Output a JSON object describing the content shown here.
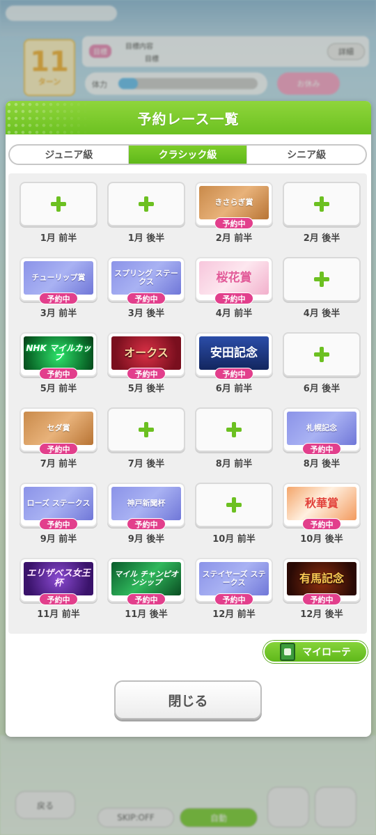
{
  "background": {
    "turn_number": "11",
    "turn_unit": "ターン",
    "goal_tag": "目標",
    "goal_line1": "目標内容",
    "goal_line2": "目標",
    "goal_button": "詳細",
    "energy_label": "体力",
    "energy_fraction": 0.14,
    "pink_button": "お休み",
    "bottom_buttons": {
      "back": "戻る",
      "skip": "SKIP:OFF",
      "auto": "自動"
    }
  },
  "modal": {
    "title": "予約レース一覧",
    "tabs": [
      {
        "label": "ジュニア級",
        "active": false
      },
      {
        "label": "クラシック級",
        "active": true
      },
      {
        "label": "シニア級",
        "active": false
      }
    ],
    "reserved_badge": "予約中",
    "slots": [
      {
        "label": "1月 前半",
        "race": null,
        "style": null
      },
      {
        "label": "1月 後半",
        "race": null,
        "style": null
      },
      {
        "label": "2月 前半",
        "race": "きさらぎ賞",
        "style": "b-bronze"
      },
      {
        "label": "2月 後半",
        "race": null,
        "style": null
      },
      {
        "label": "3月 前半",
        "race": "チューリップ賞",
        "style": "b-blue"
      },
      {
        "label": "3月 後半",
        "race": "スプリング ステークス",
        "style": "b-blue"
      },
      {
        "label": "4月 前半",
        "race": "桜花賞",
        "style": "b-pink"
      },
      {
        "label": "4月 後半",
        "race": null,
        "style": null
      },
      {
        "label": "5月 前半",
        "race": "NHK マイルカップ",
        "style": "b-green"
      },
      {
        "label": "5月 後半",
        "race": "オークス",
        "style": "b-red"
      },
      {
        "label": "6月 前半",
        "race": "安田記念",
        "style": "b-navy"
      },
      {
        "label": "6月 後半",
        "race": null,
        "style": null
      },
      {
        "label": "7月 前半",
        "race": "セダ賞",
        "style": "b-bronze"
      },
      {
        "label": "7月 後半",
        "race": null,
        "style": null
      },
      {
        "label": "8月 前半",
        "race": null,
        "style": null
      },
      {
        "label": "8月 後半",
        "race": "札幌記念",
        "style": "b-blue"
      },
      {
        "label": "9月 前半",
        "race": "ローズ ステークス",
        "style": "b-blue"
      },
      {
        "label": "9月 後半",
        "race": "神戸新聞杯",
        "style": "b-blue"
      },
      {
        "label": "10月 前半",
        "race": null,
        "style": null
      },
      {
        "label": "10月 後半",
        "race": "秋華賞",
        "style": "b-autumn"
      },
      {
        "label": "11月 前半",
        "race": "エリザベス女王杯",
        "style": "b-purple"
      },
      {
        "label": "11月 後半",
        "race": "マイル チャンピオンシップ",
        "style": "b-emerald"
      },
      {
        "label": "12月 前半",
        "race": "ステイヤーズ ステークス",
        "style": "b-blue"
      },
      {
        "label": "12月 後半",
        "race": "有馬記念",
        "style": "b-dark"
      }
    ],
    "my_route_label": "マイローテ",
    "close_label": "閉じる"
  },
  "colors": {
    "accent_green": "#6cc121",
    "badge_pink": "#e23f8c"
  }
}
